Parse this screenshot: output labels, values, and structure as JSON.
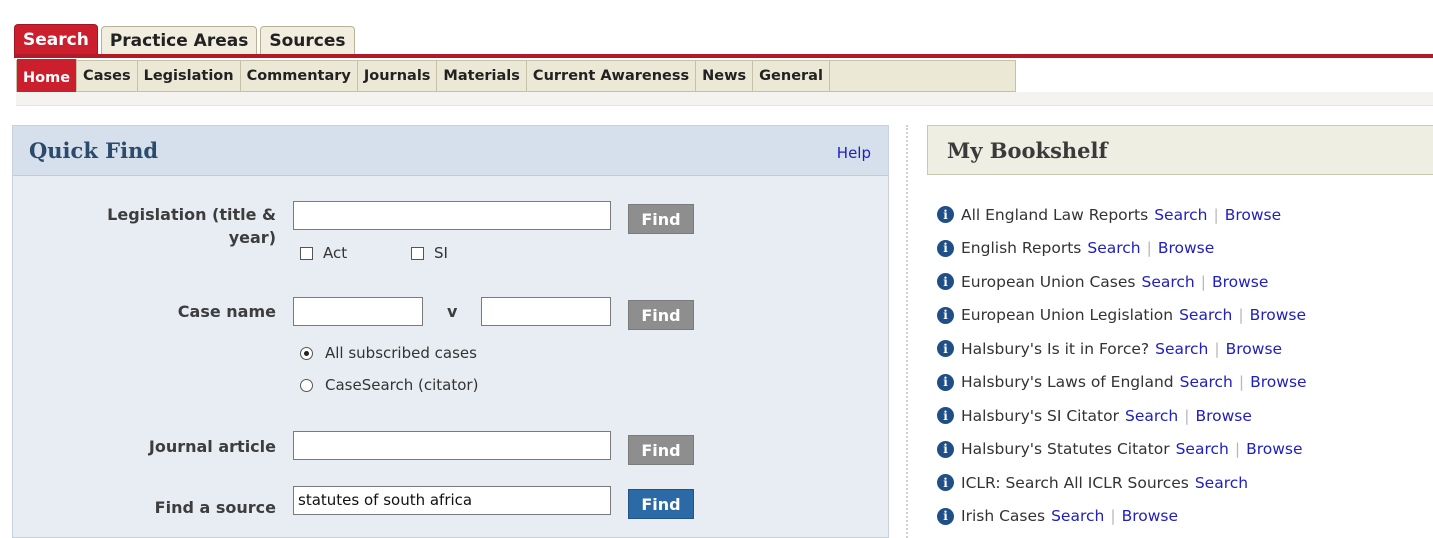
{
  "top_tabs": [
    {
      "label": "Search",
      "active": true
    },
    {
      "label": "Practice Areas",
      "active": false
    },
    {
      "label": "Sources",
      "active": false
    }
  ],
  "sub_nav": [
    {
      "label": "Home",
      "active": true
    },
    {
      "label": "Cases"
    },
    {
      "label": "Legislation"
    },
    {
      "label": "Commentary"
    },
    {
      "label": "Journals"
    },
    {
      "label": "Materials"
    },
    {
      "label": "Current Awareness"
    },
    {
      "label": "News"
    },
    {
      "label": "General"
    }
  ],
  "quick_find": {
    "title": "Quick Find",
    "help": "Help",
    "legislation_label_line1": "Legislation (title &",
    "legislation_label_line2": "year)",
    "legislation_value": "",
    "act_label": "Act",
    "si_label": "SI",
    "case_name_label": "Case name",
    "case_party1": "",
    "versus": "v",
    "case_party2": "",
    "radio_all": "All subscribed cases",
    "radio_casesearch": "CaseSearch (citator)",
    "journal_label": "Journal article",
    "journal_value": "",
    "source_label": "Find a source",
    "source_value": "statutes of south africa",
    "find_label": "Find"
  },
  "bookshelf": {
    "title": "My Bookshelf",
    "search_label": "Search",
    "browse_label": "Browse",
    "items": [
      {
        "name": "All England Law Reports",
        "browse": true
      },
      {
        "name": "English Reports",
        "browse": true
      },
      {
        "name": "European Union Cases",
        "browse": true
      },
      {
        "name": "European Union Legislation",
        "browse": true
      },
      {
        "name": "Halsbury's Is it in Force?",
        "browse": true
      },
      {
        "name": "Halsbury's Laws of England",
        "browse": true
      },
      {
        "name": "Halsbury's SI Citator",
        "browse": true
      },
      {
        "name": "Halsbury's Statutes Citator",
        "browse": true
      },
      {
        "name": "ICLR: Search All ICLR Sources",
        "browse": false
      },
      {
        "name": "Irish Cases",
        "browse": true
      }
    ]
  },
  "colors": {
    "accent_red": "#cc1f2e",
    "link": "#2020c0",
    "panel_blue": "#e8edf4",
    "find_blue": "#2c6aa7"
  }
}
